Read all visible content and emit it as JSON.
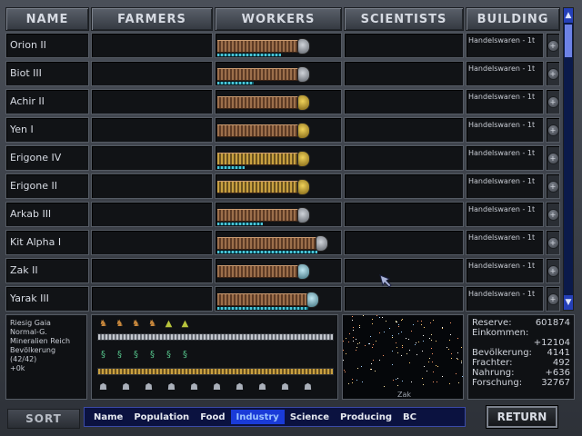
{
  "headers": {
    "name": "NAME",
    "farmers": "FARMERS",
    "workers": "WORKERS",
    "scientists": "SCIENTISTS",
    "building": "BUILDING"
  },
  "colonies": [
    {
      "name": "Orion II",
      "building": "Handelswaren - 1t"
    },
    {
      "name": "Biot III",
      "building": "Handelswaren - 1t"
    },
    {
      "name": "Achir II",
      "building": "Handelswaren - 1t"
    },
    {
      "name": "Yen I",
      "building": "Handelswaren - 1t"
    },
    {
      "name": "Erigone IV",
      "building": "Handelswaren - 1t"
    },
    {
      "name": "Erigone II",
      "building": "Handelswaren - 1t"
    },
    {
      "name": "Arkab III",
      "building": "Handelswaren - 1t"
    },
    {
      "name": "Kit Alpha I",
      "building": "Handelswaren - 1t"
    },
    {
      "name": "Zak II",
      "building": "Handelswaren - 1t"
    },
    {
      "name": "Yarak III",
      "building": "Handelswaren - 1t"
    }
  ],
  "planet_info": {
    "line1": "Riesig Gaia",
    "line2": "Normal-G.",
    "line3": "Mineralien Reich",
    "line4": "Bevölkerung",
    "line5": "(42/42)",
    "line6": "+0k"
  },
  "map": {
    "label": "Zak"
  },
  "stats": {
    "reserve_label": "Reserve:",
    "reserve_value": "601874",
    "income_label": "Einkommen:",
    "income_value": "+12104",
    "population_label": "Bevölkerung:",
    "population_value": "4141",
    "freighters_label": "Frachter:",
    "freighters_value": "492",
    "food_label": "Nahrung:",
    "food_value": "+636",
    "research_label": "Forschung:",
    "research_value": "32767"
  },
  "sort": {
    "label": "SORT",
    "buttons": [
      "Name",
      "Population",
      "Food",
      "Industry",
      "Science",
      "Producing",
      "BC"
    ],
    "active_index": 3
  },
  "return_label": "RETURN",
  "colors": {
    "accent_blue": "#1a3bd8",
    "panel_bg": "#111316",
    "frame": "#4a4f58"
  }
}
